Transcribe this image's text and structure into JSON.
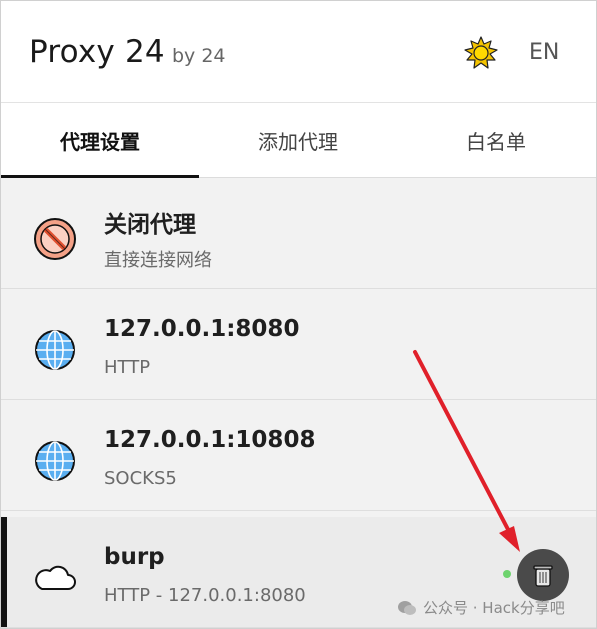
{
  "header": {
    "title": "Proxy 24",
    "by": "by 24",
    "theme_icon": "sun-icon",
    "lang_button": "EN"
  },
  "tabs": [
    {
      "label": "代理设置",
      "active": true
    },
    {
      "label": "添加代理",
      "active": false
    },
    {
      "label": "白名单",
      "active": false
    }
  ],
  "proxies": [
    {
      "name": "关闭代理",
      "detail": "直接连接网络",
      "icon": "no-entry-icon"
    },
    {
      "name": "127.0.0.1:8080",
      "detail": "HTTP",
      "icon": "globe-icon"
    },
    {
      "name": "127.0.0.1:10808",
      "detail": "SOCKS5",
      "icon": "globe-icon"
    },
    {
      "name": "burp",
      "detail": "HTTP - 127.0.0.1:8080",
      "icon": "cloud-icon",
      "selected": true,
      "status": "active"
    }
  ],
  "actions": {
    "delete_icon": "trash-icon"
  },
  "colors": {
    "accent": "#111111",
    "status_green": "#6dd36d",
    "annotation_arrow": "#e0202a"
  },
  "watermark": "公众号 · Hack分享吧"
}
